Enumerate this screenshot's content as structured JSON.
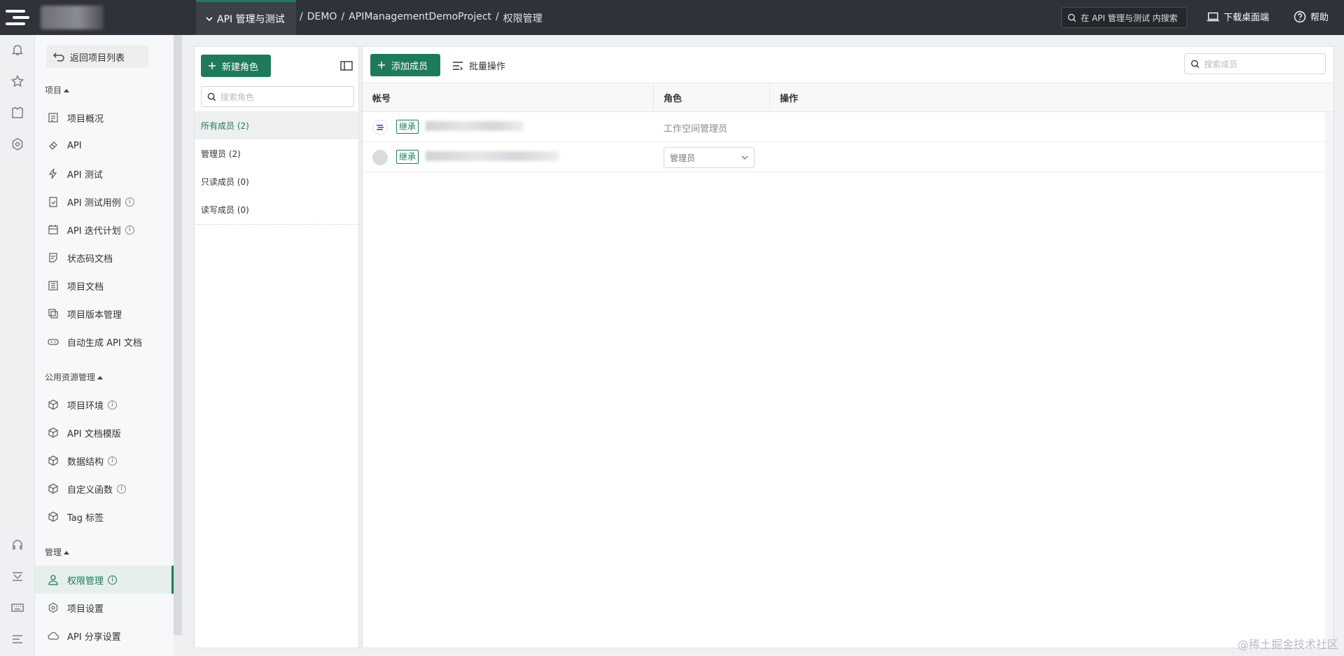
{
  "topbar": {
    "module_tab": "API 管理与测试",
    "breadcrumb": [
      "/",
      "DEMO",
      "/",
      "APIManagementDemoProject",
      "/",
      "权限管理"
    ],
    "search_placeholder": "在 API 管理与测试 内搜索",
    "download_label": "下载桌面端",
    "help_label": "帮助"
  },
  "sidebar": {
    "back_label": "返回项目列表",
    "sections": [
      {
        "title": "项目",
        "items": [
          {
            "label": "项目概况",
            "info": false
          },
          {
            "label": "API",
            "info": false
          },
          {
            "label": "API 测试",
            "info": false
          },
          {
            "label": "API 测试用例",
            "info": true
          },
          {
            "label": "API 迭代计划",
            "info": true
          },
          {
            "label": "状态码文档",
            "info": false
          },
          {
            "label": "项目文档",
            "info": false
          },
          {
            "label": "项目版本管理",
            "info": false
          },
          {
            "label": "自动生成 API 文档",
            "info": false
          }
        ]
      },
      {
        "title": "公用资源管理",
        "items": [
          {
            "label": "项目环境",
            "info": true
          },
          {
            "label": "API 文档模版",
            "info": false
          },
          {
            "label": "数据结构",
            "info": true
          },
          {
            "label": "自定义函数",
            "info": true
          },
          {
            "label": "Tag 标签",
            "info": false
          }
        ]
      },
      {
        "title": "管理",
        "items": [
          {
            "label": "权限管理",
            "info": true,
            "active": true
          },
          {
            "label": "项目设置",
            "info": false
          },
          {
            "label": "API 分享设置",
            "info": false
          }
        ]
      }
    ]
  },
  "roles": {
    "new_role_label": "新建角色",
    "search_placeholder": "搜索角色",
    "items": [
      "所有成员 (2)",
      "管理员 (2)",
      "只读成员 (0)",
      "读写成员 (0)"
    ]
  },
  "members": {
    "add_label": "添加成员",
    "batch_label": "批量操作",
    "search_placeholder": "搜索成员",
    "columns": [
      "帐号",
      "角色",
      "操作"
    ],
    "rows": [
      {
        "tag": "继承",
        "role": "工作空间管理员"
      },
      {
        "tag": "继承",
        "role": "管理员"
      }
    ]
  },
  "watermark": "@稀土掘金技术社区",
  "colors": {
    "accent": "#1f7a5a",
    "topbar": "#2f3238"
  }
}
